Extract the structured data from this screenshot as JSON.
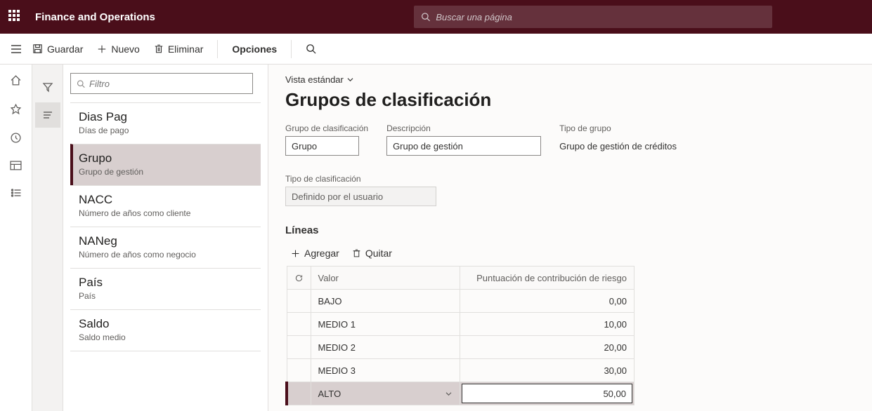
{
  "header": {
    "app_title": "Finance and Operations",
    "search_placeholder": "Buscar una página"
  },
  "commands": {
    "save": "Guardar",
    "new": "Nuevo",
    "delete": "Eliminar",
    "options": "Opciones"
  },
  "list_panel": {
    "filter_placeholder": "Filtro",
    "items": [
      {
        "title": "Dias Pag",
        "subtitle": "Días de pago"
      },
      {
        "title": "Grupo",
        "subtitle": "Grupo de gestión"
      },
      {
        "title": "NACC",
        "subtitle": "Número de años como cliente"
      },
      {
        "title": "NANeg",
        "subtitle": "Número de años como negocio"
      },
      {
        "title": "País",
        "subtitle": "País"
      },
      {
        "title": "Saldo",
        "subtitle": "Saldo medio"
      }
    ],
    "selected_index": 1
  },
  "content": {
    "view_label": "Vista estándar",
    "page_title": "Grupos de clasificación",
    "fields": {
      "grupo_label": "Grupo de clasificación",
      "grupo_value": "Grupo",
      "desc_label": "Descripción",
      "desc_value": "Grupo de gestión",
      "tipo_label": "Tipo de grupo",
      "tipo_value": "Grupo de gestión de créditos",
      "class_label": "Tipo de clasificación",
      "class_value": "Definido por el usuario"
    },
    "lines": {
      "section_title": "Líneas",
      "add_label": "Agregar",
      "remove_label": "Quitar",
      "columns": {
        "valor": "Valor",
        "score": "Puntuación de contribución de riesgo"
      },
      "rows": [
        {
          "valor": "BAJO",
          "score": "0,00"
        },
        {
          "valor": "MEDIO 1",
          "score": "10,00"
        },
        {
          "valor": "MEDIO 2",
          "score": "20,00"
        },
        {
          "valor": "MEDIO 3",
          "score": "30,00"
        },
        {
          "valor": "ALTO",
          "score": "50,00"
        }
      ],
      "active_row_index": 4
    }
  }
}
